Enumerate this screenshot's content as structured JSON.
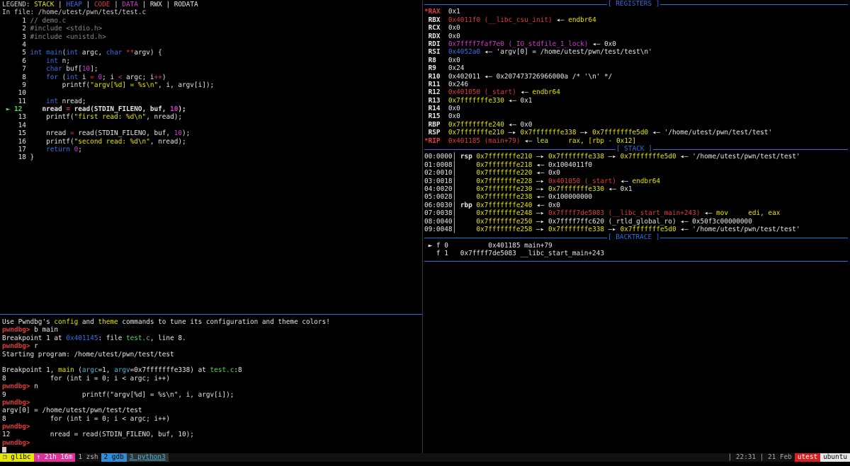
{
  "source": {
    "legend_prefix": "LEGEND: ",
    "legend": [
      {
        "t": "STACK",
        "c": "c-y"
      },
      {
        "t": " | ",
        "c": "c-w"
      },
      {
        "t": "HEAP",
        "c": "c-b"
      },
      {
        "t": " | ",
        "c": "c-w"
      },
      {
        "t": "CODE",
        "c": "c-r"
      },
      {
        "t": " | ",
        "c": "c-w"
      },
      {
        "t": "DATA",
        "c": "c-m"
      },
      {
        "t": " | ",
        "c": "c-w"
      },
      {
        "t": "RWX",
        "c": "c-w"
      },
      {
        "t": " | RODATA",
        "c": "c-w"
      }
    ],
    "file_line": "In file: /home/utest/pwn/test/test.c",
    "lines": [
      [
        {
          "t": "     1 ",
          "c": "c-w"
        },
        {
          "t": "// demo.c",
          "c": "c-gr"
        }
      ],
      [
        {
          "t": "     2 ",
          "c": "c-w"
        },
        {
          "t": "#include <stdio.h>",
          "c": "c-gr"
        }
      ],
      [
        {
          "t": "     3 ",
          "c": "c-w"
        },
        {
          "t": "#include <unistd.h>",
          "c": "c-gr"
        }
      ],
      [
        {
          "t": "     4",
          "c": "c-w"
        }
      ],
      [
        {
          "t": "     5 ",
          "c": "c-w"
        },
        {
          "t": "int ",
          "c": "c-b"
        },
        {
          "t": "main",
          "c": "c-b"
        },
        {
          "t": "(",
          "c": "c-w"
        },
        {
          "t": "int ",
          "c": "c-b"
        },
        {
          "t": "argc, ",
          "c": "c-w"
        },
        {
          "t": "char ",
          "c": "c-b"
        },
        {
          "t": "**",
          "c": "c-r"
        },
        {
          "t": "argv) {",
          "c": "c-w"
        }
      ],
      [
        {
          "t": "     6     ",
          "c": "c-w"
        },
        {
          "t": "int ",
          "c": "c-b"
        },
        {
          "t": "n;",
          "c": "c-w"
        }
      ],
      [
        {
          "t": "     7     ",
          "c": "c-w"
        },
        {
          "t": "char ",
          "c": "c-b"
        },
        {
          "t": "buf[",
          "c": "c-w"
        },
        {
          "t": "10",
          "c": "c-m"
        },
        {
          "t": "];",
          "c": "c-w"
        }
      ],
      [
        {
          "t": "     8     ",
          "c": "c-w"
        },
        {
          "t": "for ",
          "c": "c-b"
        },
        {
          "t": "(",
          "c": "c-w"
        },
        {
          "t": "int ",
          "c": "c-b"
        },
        {
          "t": "i ",
          "c": "c-w"
        },
        {
          "t": "= ",
          "c": "c-r"
        },
        {
          "t": "0",
          "c": "c-m"
        },
        {
          "t": "; i ",
          "c": "c-w"
        },
        {
          "t": "< ",
          "c": "c-r"
        },
        {
          "t": "argc; i",
          "c": "c-w"
        },
        {
          "t": "++",
          "c": "c-r"
        },
        {
          "t": ")",
          "c": "c-w"
        }
      ],
      [
        {
          "t": "     9         printf(",
          "c": "c-w"
        },
        {
          "t": "\"argv[%d] = %s\\n\"",
          "c": "c-y"
        },
        {
          "t": ", i, argv[i]);",
          "c": "c-w"
        }
      ],
      [
        {
          "t": "    10",
          "c": "c-w"
        }
      ],
      [
        {
          "t": "    11     ",
          "c": "c-w"
        },
        {
          "t": "int ",
          "c": "c-b"
        },
        {
          "t": "nread;",
          "c": "c-w"
        }
      ],
      [
        {
          "t": " ► ",
          "c": "c-g"
        },
        {
          "t": "12     ",
          "c": "c-g bold"
        },
        {
          "t": "nread ",
          "c": "c-w bold"
        },
        {
          "t": "= ",
          "c": "c-r bold"
        },
        {
          "t": "read(STDIN_FILENO, buf, ",
          "c": "c-w bold"
        },
        {
          "t": "10",
          "c": "c-m bold"
        },
        {
          "t": ");",
          "c": "c-w bold"
        }
      ],
      [
        {
          "t": "    13     printf(",
          "c": "c-w"
        },
        {
          "t": "\"first read: %d\\n\"",
          "c": "c-y"
        },
        {
          "t": ", nread);",
          "c": "c-w"
        }
      ],
      [
        {
          "t": "    14",
          "c": "c-w"
        }
      ],
      [
        {
          "t": "    15     nread ",
          "c": "c-w"
        },
        {
          "t": "= ",
          "c": "c-r"
        },
        {
          "t": "read(STDIN_FILENO, buf, ",
          "c": "c-w"
        },
        {
          "t": "10",
          "c": "c-m"
        },
        {
          "t": ");",
          "c": "c-w"
        }
      ],
      [
        {
          "t": "    16     printf(",
          "c": "c-w"
        },
        {
          "t": "\"second read: %d\\n\"",
          "c": "c-y"
        },
        {
          "t": ", nread);",
          "c": "c-w"
        }
      ],
      [
        {
          "t": "    17     ",
          "c": "c-w"
        },
        {
          "t": "return ",
          "c": "c-b"
        },
        {
          "t": "0",
          "c": "c-m"
        },
        {
          "t": ";",
          "c": "c-w"
        }
      ],
      [
        {
          "t": "    18 }",
          "c": "c-w"
        }
      ]
    ]
  },
  "console": {
    "lines": [
      [
        {
          "t": "Use Pwndbg's ",
          "c": "c-w"
        },
        {
          "t": "config",
          "c": "c-y"
        },
        {
          "t": " and ",
          "c": "c-w"
        },
        {
          "t": "theme",
          "c": "c-y"
        },
        {
          "t": " commands to tune its configuration and theme colors!",
          "c": "c-w"
        }
      ],
      [
        {
          "t": "pwndbg> ",
          "c": "c-r bold"
        },
        {
          "t": "b main",
          "c": "c-w"
        }
      ],
      [
        {
          "t": "Breakpoint 1 at ",
          "c": "c-w"
        },
        {
          "t": "0x401145",
          "c": "c-b"
        },
        {
          "t": ": file ",
          "c": "c-w"
        },
        {
          "t": "test.c",
          "c": "c-g"
        },
        {
          "t": ", line 8.",
          "c": "c-w"
        }
      ],
      [
        {
          "t": "pwndbg> ",
          "c": "c-r bold"
        },
        {
          "t": "r",
          "c": "c-w"
        }
      ],
      [
        {
          "t": "Starting program: /home/utest/pwn/test/test",
          "c": "c-w"
        }
      ],
      [
        {
          "t": "",
          "c": "c-w"
        }
      ],
      [
        {
          "t": "Breakpoint 1, ",
          "c": "c-w"
        },
        {
          "t": "main",
          "c": "c-y"
        },
        {
          "t": " (",
          "c": "c-w"
        },
        {
          "t": "argc",
          "c": "c-c"
        },
        {
          "t": "=1, ",
          "c": "c-w"
        },
        {
          "t": "argv",
          "c": "c-c"
        },
        {
          "t": "=0x7fffffffe338) at ",
          "c": "c-w"
        },
        {
          "t": "test.c",
          "c": "c-g"
        },
        {
          "t": ":8",
          "c": "c-w"
        }
      ],
      [
        {
          "t": "8           for (int i = 0; i < argc; i++)",
          "c": "c-w"
        }
      ],
      [
        {
          "t": "pwndbg> ",
          "c": "c-r bold"
        },
        {
          "t": "n",
          "c": "c-w"
        }
      ],
      [
        {
          "t": "9                   printf(\"argv[%d] = %s\\n\", i, argv[i]);",
          "c": "c-w"
        }
      ],
      [
        {
          "t": "pwndbg>",
          "c": "c-r bold"
        }
      ],
      [
        {
          "t": "argv[0] = /home/utest/pwn/test/test",
          "c": "c-w"
        }
      ],
      [
        {
          "t": "8           for (int i = 0; i < argc; i++)",
          "c": "c-w"
        }
      ],
      [
        {
          "t": "pwndbg>",
          "c": "c-r bold"
        }
      ],
      [
        {
          "t": "12          nread = read(STDIN_FILENO, buf, 10);",
          "c": "c-w"
        }
      ],
      [
        {
          "t": "pwndbg>",
          "c": "c-r bold"
        }
      ]
    ]
  },
  "registers": {
    "title": "[ REGISTERS ]",
    "lines": [
      [
        {
          "t": "*RAX  ",
          "c": "c-r bold"
        },
        {
          "t": "0x1",
          "c": "c-w"
        }
      ],
      [
        {
          "t": " RBX  ",
          "c": "c-w bold"
        },
        {
          "t": "0x4011f0 (__libc_csu_init)",
          "c": "c-r"
        },
        {
          "t": " ◂— ",
          "c": "c-w"
        },
        {
          "t": "endbr64",
          "c": "c-y"
        }
      ],
      [
        {
          "t": " RCX  ",
          "c": "c-w bold"
        },
        {
          "t": "0x0",
          "c": "c-w"
        }
      ],
      [
        {
          "t": " RDX  ",
          "c": "c-w bold"
        },
        {
          "t": "0x0",
          "c": "c-w"
        }
      ],
      [
        {
          "t": " RDI  ",
          "c": "c-w bold"
        },
        {
          "t": "0x7ffff7faf7e0 (_IO_stdfile_1_lock)",
          "c": "c-m"
        },
        {
          "t": " ◂— 0x0",
          "c": "c-w"
        }
      ],
      [
        {
          "t": " RSI  ",
          "c": "c-w bold"
        },
        {
          "t": "0x4052a0",
          "c": "c-b"
        },
        {
          "t": " ◂— 'argv[0] = /home/utest/pwn/test/test\\n'",
          "c": "c-w"
        }
      ],
      [
        {
          "t": " R8   ",
          "c": "c-w bold"
        },
        {
          "t": "0x0",
          "c": "c-w"
        }
      ],
      [
        {
          "t": " R9   ",
          "c": "c-w bold"
        },
        {
          "t": "0x24",
          "c": "c-w"
        }
      ],
      [
        {
          "t": " R10  ",
          "c": "c-w bold"
        },
        {
          "t": "0x402011 ◂— 0x207473726966000a /* '\\n' */",
          "c": "c-w"
        }
      ],
      [
        {
          "t": " R11  ",
          "c": "c-w bold"
        },
        {
          "t": "0x246",
          "c": "c-w"
        }
      ],
      [
        {
          "t": " R12  ",
          "c": "c-w bold"
        },
        {
          "t": "0x401050 (_start)",
          "c": "c-r"
        },
        {
          "t": " ◂— ",
          "c": "c-w"
        },
        {
          "t": "endbr64",
          "c": "c-y"
        }
      ],
      [
        {
          "t": " R13  ",
          "c": "c-w bold"
        },
        {
          "t": "0x7fffffffe330",
          "c": "c-y"
        },
        {
          "t": " ◂— 0x1",
          "c": "c-w"
        }
      ],
      [
        {
          "t": " R14  ",
          "c": "c-w bold"
        },
        {
          "t": "0x0",
          "c": "c-w"
        }
      ],
      [
        {
          "t": " R15  ",
          "c": "c-w bold"
        },
        {
          "t": "0x0",
          "c": "c-w"
        }
      ],
      [
        {
          "t": " RBP  ",
          "c": "c-w bold"
        },
        {
          "t": "0x7fffffffe240",
          "c": "c-y"
        },
        {
          "t": " ◂— 0x0",
          "c": "c-w"
        }
      ],
      [
        {
          "t": " RSP  ",
          "c": "c-w bold"
        },
        {
          "t": "0x7fffffffe210",
          "c": "c-y"
        },
        {
          "t": " —▸ ",
          "c": "c-w"
        },
        {
          "t": "0x7fffffffe338",
          "c": "c-y"
        },
        {
          "t": " —▸ ",
          "c": "c-w"
        },
        {
          "t": "0x7fffffffe5d0",
          "c": "c-y"
        },
        {
          "t": " ◂— '/home/utest/pwn/test/test'",
          "c": "c-w"
        }
      ],
      [
        {
          "t": "*RIP  ",
          "c": "c-r bold"
        },
        {
          "t": "0x401185 (main+79)",
          "c": "c-r"
        },
        {
          "t": " ◂— ",
          "c": "c-w"
        },
        {
          "t": "lea     rax, [rbp - 0x12]",
          "c": "c-y"
        }
      ]
    ]
  },
  "stack": {
    "title": "[ STACK ]",
    "lines": [
      [
        {
          "t": "00:0000│ ",
          "c": "c-w"
        },
        {
          "t": "rsp ",
          "c": "c-w bold"
        },
        {
          "t": "0x7fffffffe210",
          "c": "c-y"
        },
        {
          "t": " —▸ ",
          "c": "c-w"
        },
        {
          "t": "0x7fffffffe338",
          "c": "c-y"
        },
        {
          "t": " —▸ ",
          "c": "c-w"
        },
        {
          "t": "0x7fffffffe5d0",
          "c": "c-y"
        },
        {
          "t": " ◂— '/home/utest/pwn/test/test'",
          "c": "c-w"
        }
      ],
      [
        {
          "t": "01:0008│     ",
          "c": "c-w"
        },
        {
          "t": "0x7fffffffe218",
          "c": "c-y"
        },
        {
          "t": " ◂— 0x1004011f0",
          "c": "c-w"
        }
      ],
      [
        {
          "t": "02:0010│     ",
          "c": "c-w"
        },
        {
          "t": "0x7fffffffe220",
          "c": "c-y"
        },
        {
          "t": " ◂— 0x0",
          "c": "c-w"
        }
      ],
      [
        {
          "t": "03:0018│     ",
          "c": "c-w"
        },
        {
          "t": "0x7fffffffe228",
          "c": "c-y"
        },
        {
          "t": " —▸ ",
          "c": "c-w"
        },
        {
          "t": "0x401050 (_start)",
          "c": "c-r"
        },
        {
          "t": " ◂— ",
          "c": "c-w"
        },
        {
          "t": "endbr64",
          "c": "c-y"
        }
      ],
      [
        {
          "t": "04:0020│     ",
          "c": "c-w"
        },
        {
          "t": "0x7fffffffe230",
          "c": "c-y"
        },
        {
          "t": " —▸ ",
          "c": "c-w"
        },
        {
          "t": "0x7fffffffe330",
          "c": "c-y"
        },
        {
          "t": " ◂— 0x1",
          "c": "c-w"
        }
      ],
      [
        {
          "t": "05:0028│     ",
          "c": "c-w"
        },
        {
          "t": "0x7fffffffe238",
          "c": "c-y"
        },
        {
          "t": " ◂— 0x100000000",
          "c": "c-w"
        }
      ],
      [
        {
          "t": "06:0030│ ",
          "c": "c-w"
        },
        {
          "t": "rbp ",
          "c": "c-w bold"
        },
        {
          "t": "0x7fffffffe240",
          "c": "c-y"
        },
        {
          "t": " ◂— 0x0",
          "c": "c-w"
        }
      ],
      [
        {
          "t": "07:0038│     ",
          "c": "c-w"
        },
        {
          "t": "0x7fffffffe248",
          "c": "c-y"
        },
        {
          "t": " —▸ ",
          "c": "c-w"
        },
        {
          "t": "0x7ffff7de5083 (__libc_start_main+243)",
          "c": "c-r"
        },
        {
          "t": " ◂— ",
          "c": "c-w"
        },
        {
          "t": "mov     edi, eax",
          "c": "c-y"
        }
      ],
      [
        {
          "t": "08:0040│     ",
          "c": "c-w"
        },
        {
          "t": "0x7fffffffe250",
          "c": "c-y"
        },
        {
          "t": " —▸ 0x7ffff7ffc620 (_rtld_global_ro) ◂— 0x50f3c00000000",
          "c": "c-w"
        }
      ],
      [
        {
          "t": "09:0048│     ",
          "c": "c-w"
        },
        {
          "t": "0x7fffffffe258",
          "c": "c-y"
        },
        {
          "t": " —▸ ",
          "c": "c-w"
        },
        {
          "t": "0x7fffffffe338",
          "c": "c-y"
        },
        {
          "t": " —▸ ",
          "c": "c-w"
        },
        {
          "t": "0x7fffffffe5d0",
          "c": "c-y"
        },
        {
          "t": " ◂— '/home/utest/pwn/test/test'",
          "c": "c-w"
        }
      ]
    ]
  },
  "backtrace": {
    "title": "[ BACKTRACE ]",
    "lines": [
      [
        {
          "t": " ► f 0          0x401185 main+79",
          "c": "c-w"
        }
      ],
      [
        {
          "t": "   f 1   0x7ffff7de5083 __libc_start_main+243",
          "c": "c-w"
        }
      ]
    ]
  },
  "statusbar": {
    "session": "❐ glibc",
    "uptime": "↑ 21h 16m",
    "win1": "1 zsh",
    "win2": "2 gdb",
    "win3": "3 python3",
    "time": "| 22:31 | 21 Feb",
    "user": "utest",
    "host": "ubuntu",
    "colors": {
      "session": "#e6e600",
      "uptime": "#e0309c",
      "win2": "#2a8fd6",
      "user": "#d81e1e",
      "host": "#e8e8e8"
    }
  }
}
